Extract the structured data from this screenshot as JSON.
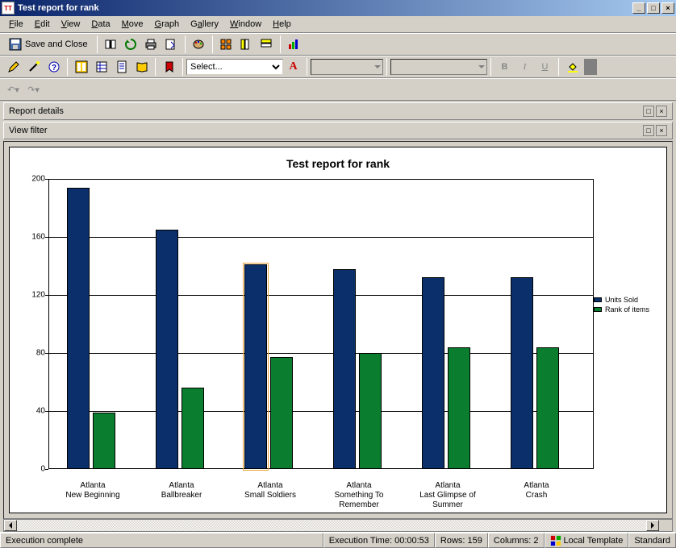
{
  "window": {
    "title": "Test report for rank",
    "min": "_",
    "max": "□",
    "close": "×"
  },
  "menu": {
    "file": "File",
    "edit": "Edit",
    "view": "View",
    "data": "Data",
    "move": "Move",
    "graph": "Graph",
    "gallery": "Gallery",
    "window": "Window",
    "help": "Help"
  },
  "toolbar": {
    "save_and_close": "Save and Close",
    "select_placeholder": "Select...",
    "bold": "B",
    "italic": "I",
    "underline": "U"
  },
  "panels": {
    "report_details": "Report details",
    "view_filter": "View filter"
  },
  "status": {
    "msg": "Execution complete",
    "exec_time_label": "Execution Time:",
    "exec_time": "00:00:53",
    "rows_label": "Rows:",
    "rows": "159",
    "cols_label": "Columns:",
    "cols": "2",
    "template": "Local Template",
    "mode": "Standard"
  },
  "chart_data": {
    "type": "bar",
    "title": "Test report for rank",
    "ylabel": "",
    "xlabel": "",
    "ylim": [
      0,
      200
    ],
    "yticks": [
      0,
      40,
      80,
      120,
      160,
      200
    ],
    "categories": [
      "Atlanta\nNew Beginning",
      "Atlanta\nBallbreaker",
      "Atlanta\nSmall Soldiers",
      "Atlanta\nSomething To\nRemember",
      "Atlanta\nLast Glimpse of\nSummer",
      "Atlanta\nCrash"
    ],
    "series": [
      {
        "name": "Units Sold",
        "color": "#0a2f6b",
        "values": [
          194,
          165,
          141,
          138,
          132,
          132
        ]
      },
      {
        "name": "Rank of items",
        "color": "#0a7d2e",
        "values": [
          39,
          56,
          77,
          80,
          84,
          84
        ]
      }
    ],
    "selected_category_index": 2,
    "selected_series_index": 0
  }
}
